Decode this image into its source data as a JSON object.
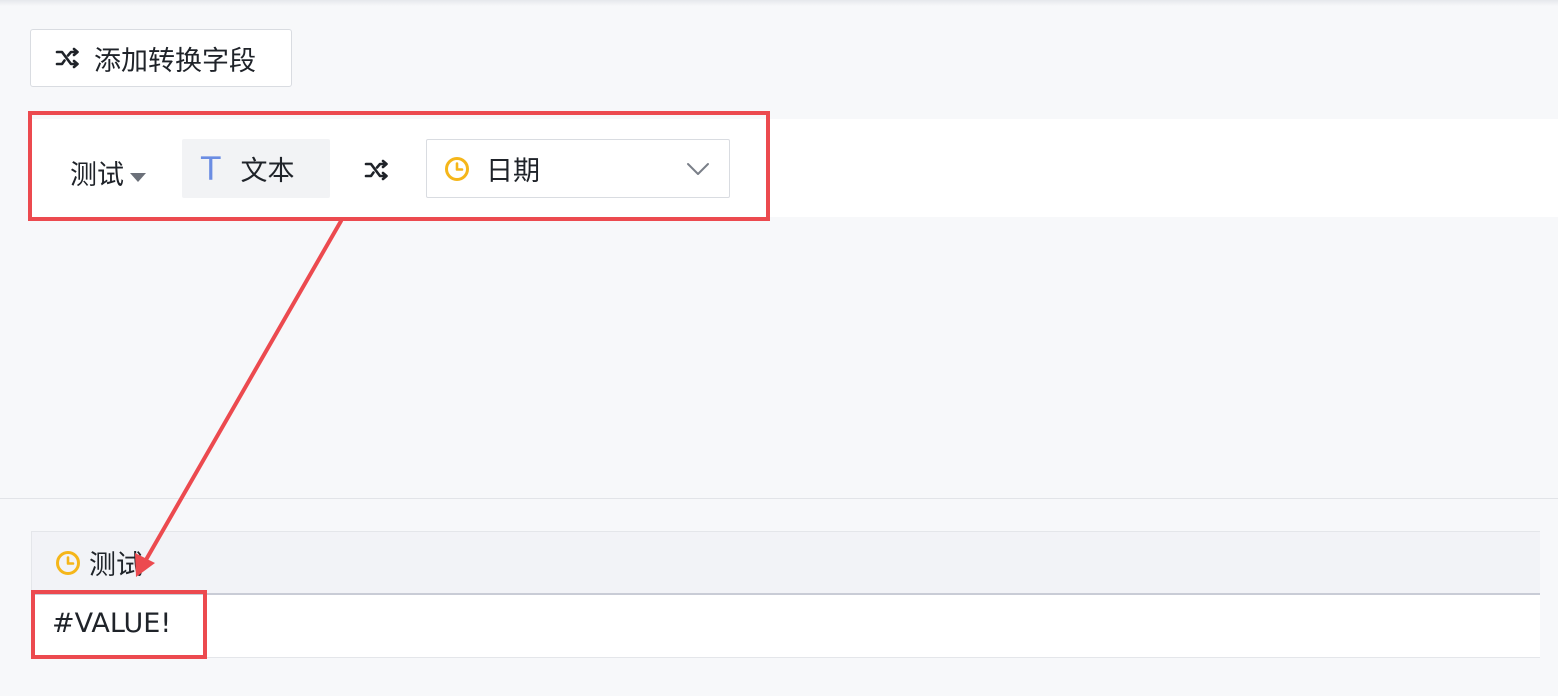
{
  "toolbar": {
    "add_button_label": "添加转换字段",
    "add_button_icon": "shuffle-icon"
  },
  "conversion_row": {
    "source_field": "测试",
    "source_type_label": "文本",
    "source_type_icon": "text-type-icon",
    "source_type_glyph": "T",
    "convert_icon": "shuffle-icon",
    "target_type_label": "日期",
    "target_type_icon": "clock-icon",
    "dropdown_icon": "chevron-down-icon"
  },
  "preview": {
    "column_header": "测试",
    "column_icon": "clock-icon",
    "cell_value": "#VALUE!"
  },
  "colors": {
    "annotation_red": "#ec4a4f",
    "date_icon_yellow": "#f5b61a",
    "text_icon_blue": "#6b8de3",
    "background": "#f7f8fa"
  }
}
